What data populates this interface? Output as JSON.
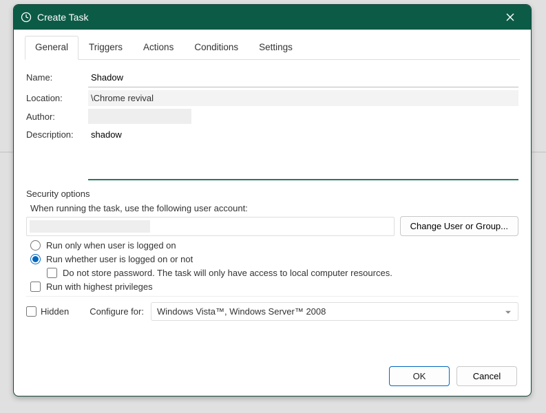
{
  "window": {
    "title": "Create Task"
  },
  "tabs": {
    "general": "General",
    "triggers": "Triggers",
    "actions": "Actions",
    "conditions": "Conditions",
    "settings": "Settings"
  },
  "form": {
    "name_label": "Name:",
    "name_value": "Shadow",
    "location_label": "Location:",
    "location_value": "\\Chrome revival",
    "author_label": "Author:",
    "description_label": "Description:",
    "description_value": "shadow"
  },
  "security": {
    "section_title": "Security options",
    "prompt": "When running the task, use the following user account:",
    "change_btn": "Change User or Group...",
    "run_logged_on": "Run only when user is logged on",
    "run_whether": "Run whether user is logged on or not",
    "no_store_pw": "Do not store password.  The task will only have access to local computer resources.",
    "highest_priv": "Run with highest privileges"
  },
  "bottom": {
    "hidden_label": "Hidden",
    "configure_label": "Configure for:",
    "configure_value": "Windows Vista™, Windows Server™ 2008"
  },
  "buttons": {
    "ok": "OK",
    "cancel": "Cancel"
  }
}
